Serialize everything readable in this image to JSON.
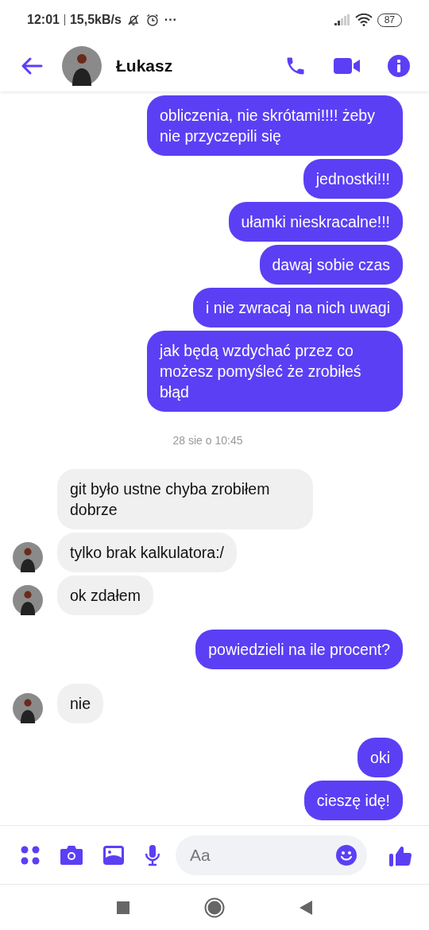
{
  "status_bar": {
    "time": "12:01",
    "speed": "15,5kB/s",
    "more": "···",
    "battery": "87"
  },
  "header": {
    "name": "Łukasz"
  },
  "messages": [
    {
      "kind": "sent",
      "text": "obliczenia, nie skrótami!!!! żeby nie przyczepili się"
    },
    {
      "kind": "sent",
      "text": "jednostki!!!"
    },
    {
      "kind": "sent",
      "text": "ułamki nieskracalne!!!"
    },
    {
      "kind": "sent",
      "text": "dawaj sobie czas"
    },
    {
      "kind": "sent",
      "text": "i nie zwracaj na nich uwagi"
    },
    {
      "kind": "sent",
      "text": "jak będą wzdychać przez co możesz pomyśleć że zrobiłeś błąd"
    },
    {
      "kind": "time",
      "text": "28 sie o 10:45"
    },
    {
      "kind": "received",
      "text": "git było ustne chyba zrobiłem dobrze",
      "show_avatar": false
    },
    {
      "kind": "received",
      "text": "tylko brak kalkulatora:/",
      "show_avatar": true
    },
    {
      "kind": "received",
      "text": "ok zdałem",
      "show_avatar": true
    },
    {
      "kind": "sent",
      "text": "powiedzieli na ile procent?"
    },
    {
      "kind": "received",
      "text": "nie",
      "show_avatar": true
    },
    {
      "kind": "sent",
      "text": "oki"
    },
    {
      "kind": "sent",
      "text": "cieszę idę!"
    }
  ],
  "composer": {
    "placeholder": "Aa"
  }
}
